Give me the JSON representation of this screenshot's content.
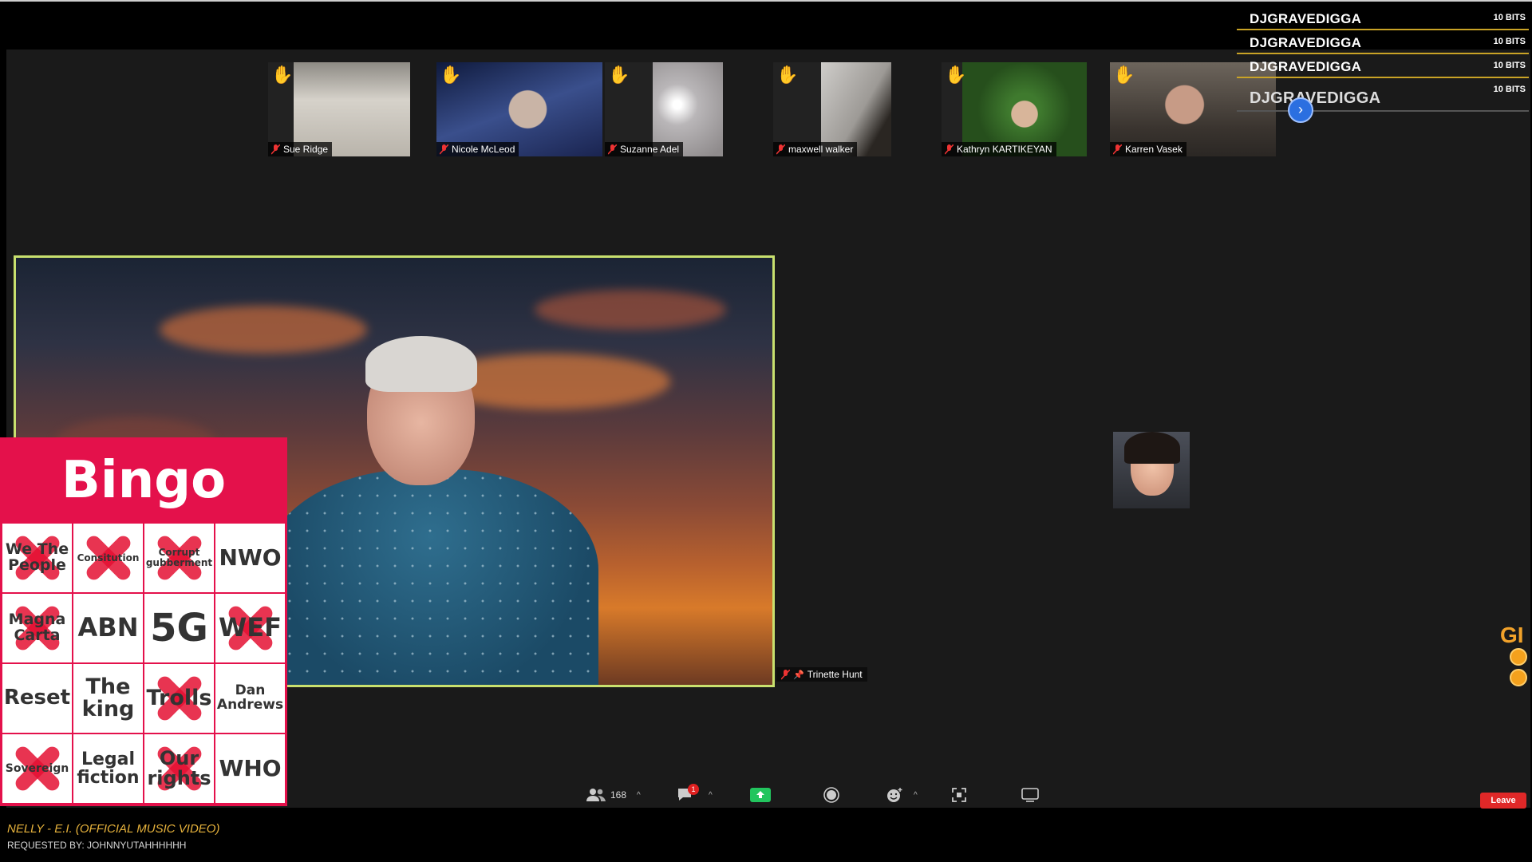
{
  "overlay": {
    "donations": [
      {
        "name": "DJGRAVEDIGGA",
        "amount": "10 BITS"
      },
      {
        "name": "DJGRAVEDIGGA",
        "amount": "10 BITS"
      },
      {
        "name": "DJGRAVEDIGGA",
        "amount": "10 BITS"
      },
      {
        "name": "DJGRAVEDIGGA",
        "amount": "10 BITS"
      }
    ],
    "now_playing": "NELLY - E.I. (OFFICIAL MUSIC VIDEO)",
    "requested_by": "REQUESTED BY: JOHNNYUTAHHHHHH",
    "gift_text": "GI"
  },
  "participants": [
    {
      "name": "Sue Ridge"
    },
    {
      "name": "Nicole McLeod"
    },
    {
      "name": "Suzanne Adel"
    },
    {
      "name": "maxwell walker"
    },
    {
      "name": "Kathryn KARTIKEYAN"
    },
    {
      "name": "Karren Vasek"
    }
  ],
  "secondary_speaker": {
    "name": "Trinette Hunt"
  },
  "bingo": {
    "title": "Bingo",
    "cells": [
      {
        "text": "We The People",
        "marked": true
      },
      {
        "text": "Consitution",
        "marked": true
      },
      {
        "text": "Corrupt gubberment",
        "marked": true
      },
      {
        "text": "NWO",
        "marked": false
      },
      {
        "text": "Magna Carta",
        "marked": true
      },
      {
        "text": "ABN",
        "marked": false
      },
      {
        "text": "5G",
        "marked": false
      },
      {
        "text": "WEF",
        "marked": true
      },
      {
        "text": "Reset",
        "marked": false
      },
      {
        "text": "The king",
        "marked": false
      },
      {
        "text": "Trolls",
        "marked": true
      },
      {
        "text": "Dan Andrews",
        "marked": false
      },
      {
        "text": "Sovereign",
        "marked": true
      },
      {
        "text": "Legal fiction",
        "marked": false
      },
      {
        "text": "Our rights",
        "marked": true
      },
      {
        "text": "WHO",
        "marked": false
      }
    ]
  },
  "toolbar": {
    "participants_count": "168",
    "chat_unread": "1",
    "leave_label": "Leave"
  },
  "colors": {
    "bingo_red": "#e4114b",
    "active_border": "#c8e06e",
    "donation_gold": "#c9a326",
    "leave_red": "#e02828"
  }
}
